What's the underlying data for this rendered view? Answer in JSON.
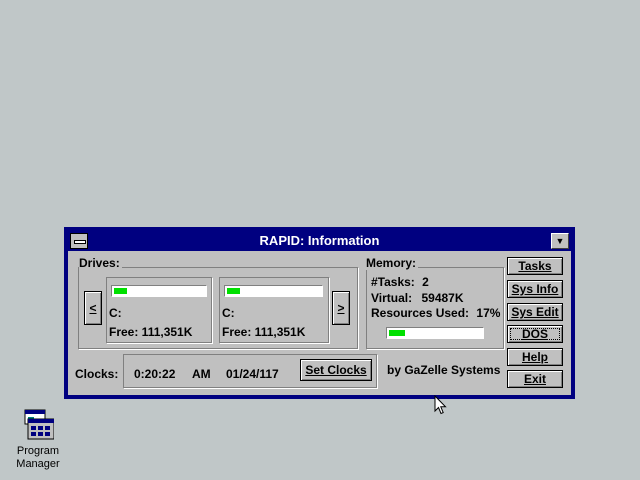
{
  "window": {
    "title": "RAPID: Information",
    "minimize_glyph": "▼"
  },
  "drives": {
    "heading": "Drives:",
    "prev_button": "<",
    "next_button": ">",
    "items": [
      {
        "letter": "C:",
        "free": "Free: 111,351K",
        "usage": 0.14
      },
      {
        "letter": "C:",
        "free": "Free: 111,351K",
        "usage": 0.14
      }
    ]
  },
  "memory": {
    "heading": "Memory:",
    "tasks_label": "#Tasks:",
    "tasks_value": "2",
    "virtual_label": "Virtual:",
    "virtual_value": "59487K",
    "resources_label": "Resources Used:",
    "resources_value": "17%",
    "resources_fraction": 0.17
  },
  "clocks": {
    "label": "Clocks:",
    "time": "0:20:22",
    "ampm": "AM",
    "date": "01/24/117",
    "set_button": "Set Clocks"
  },
  "credit": "by GaZelle Systems",
  "buttons": {
    "tasks": "Tasks",
    "sysinfo": "Sys Info",
    "sysedit": "Sys Edit",
    "dos": "DOS",
    "help": "Help",
    "exit": "Exit"
  },
  "desktop": {
    "icon_label_line1": "Program",
    "icon_label_line2": "Manager"
  }
}
